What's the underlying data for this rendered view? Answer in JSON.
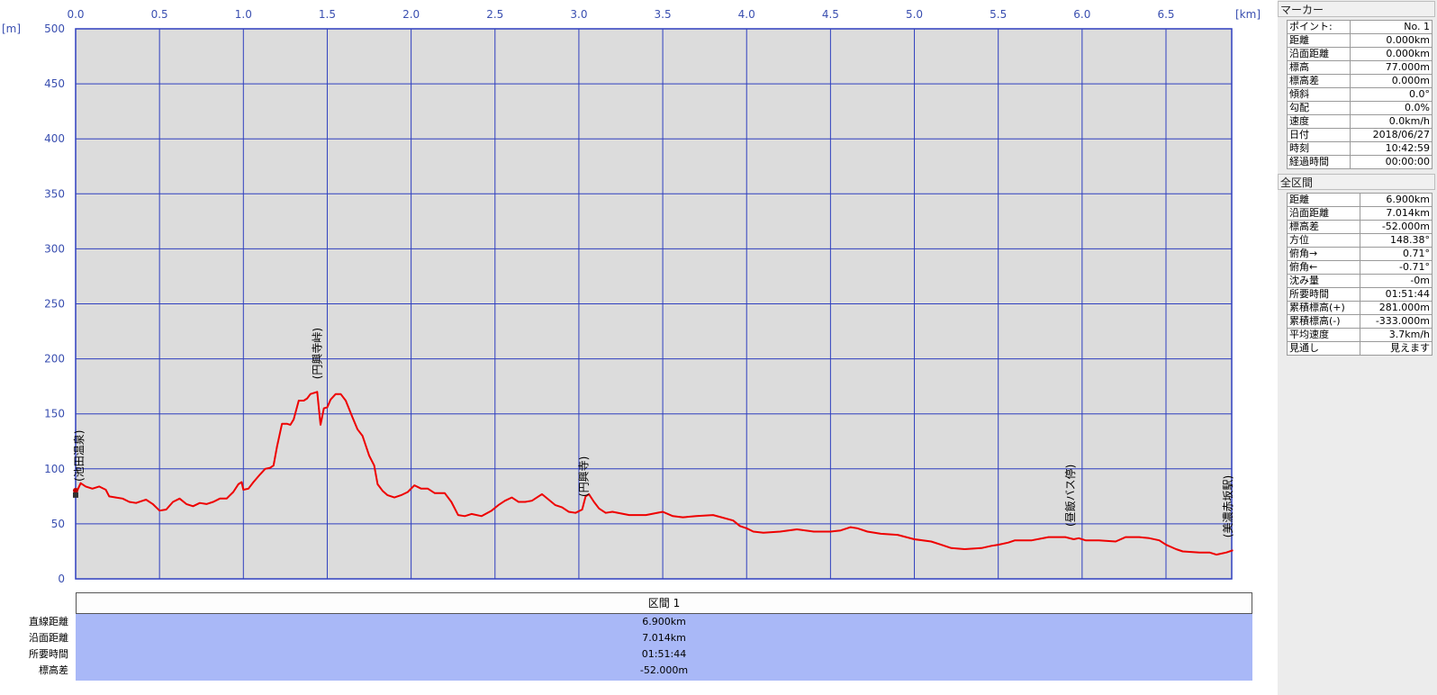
{
  "axes": {
    "x_unit": "[km]",
    "y_unit": "[m]",
    "x_ticks": [
      "0.0",
      "0.5",
      "1.0",
      "1.5",
      "2.0",
      "2.5",
      "3.0",
      "3.5",
      "4.0",
      "4.5",
      "5.0",
      "5.5",
      "6.0",
      "6.5"
    ],
    "y_ticks": [
      "0",
      "50",
      "100",
      "150",
      "200",
      "250",
      "300",
      "350",
      "400",
      "450",
      "500"
    ]
  },
  "colors": {
    "profile": "#ee0000",
    "grid": "#2f3fbf",
    "plot_bg": "#dcdcdc",
    "section_bg": "#a9b8f7"
  },
  "waypoints": [
    {
      "label": "(池田温泉)",
      "x": 0.0
    },
    {
      "label": "(円興寺峠)",
      "x": 1.44
    },
    {
      "label": "(円興寺)",
      "x": 3.03
    },
    {
      "label": "(昼飯バス停)",
      "x": 5.93
    },
    {
      "label": "(美濃赤坂駅)",
      "x": 6.9
    }
  ],
  "chart_data": {
    "type": "line",
    "xlabel": "[km]",
    "ylabel": "[m]",
    "xlim": [
      0,
      6.9
    ],
    "ylim": [
      0,
      500
    ],
    "grid": true,
    "series": [
      {
        "values": [
          [
            0.0,
            77
          ],
          [
            0.03,
            87
          ],
          [
            0.06,
            84
          ],
          [
            0.1,
            82
          ],
          [
            0.14,
            84
          ],
          [
            0.18,
            81
          ],
          [
            0.2,
            75
          ],
          [
            0.24,
            74
          ],
          [
            0.28,
            73
          ],
          [
            0.32,
            70
          ],
          [
            0.36,
            69
          ],
          [
            0.4,
            71
          ],
          [
            0.42,
            72
          ],
          [
            0.46,
            68
          ],
          [
            0.5,
            62
          ],
          [
            0.54,
            63
          ],
          [
            0.58,
            70
          ],
          [
            0.62,
            73
          ],
          [
            0.66,
            68
          ],
          [
            0.7,
            66
          ],
          [
            0.74,
            69
          ],
          [
            0.78,
            68
          ],
          [
            0.82,
            70
          ],
          [
            0.86,
            73
          ],
          [
            0.9,
            73
          ],
          [
            0.94,
            79
          ],
          [
            0.97,
            86
          ],
          [
            0.99,
            88
          ],
          [
            1.0,
            81
          ],
          [
            1.03,
            82
          ],
          [
            1.06,
            88
          ],
          [
            1.1,
            95
          ],
          [
            1.13,
            100
          ],
          [
            1.16,
            101
          ],
          [
            1.18,
            103
          ],
          [
            1.2,
            120
          ],
          [
            1.23,
            141
          ],
          [
            1.26,
            141
          ],
          [
            1.28,
            140
          ],
          [
            1.3,
            145
          ],
          [
            1.33,
            162
          ],
          [
            1.36,
            162
          ],
          [
            1.38,
            164
          ],
          [
            1.4,
            168
          ],
          [
            1.44,
            170
          ],
          [
            1.46,
            140
          ],
          [
            1.48,
            155
          ],
          [
            1.5,
            156
          ],
          [
            1.52,
            163
          ],
          [
            1.55,
            168
          ],
          [
            1.58,
            168
          ],
          [
            1.61,
            162
          ],
          [
            1.65,
            147
          ],
          [
            1.68,
            136
          ],
          [
            1.71,
            130
          ],
          [
            1.75,
            112
          ],
          [
            1.78,
            103
          ],
          [
            1.8,
            86
          ],
          [
            1.83,
            80
          ],
          [
            1.86,
            76
          ],
          [
            1.9,
            74
          ],
          [
            1.94,
            76
          ],
          [
            1.98,
            79
          ],
          [
            2.02,
            85
          ],
          [
            2.06,
            82
          ],
          [
            2.1,
            82
          ],
          [
            2.14,
            78
          ],
          [
            2.2,
            78
          ],
          [
            2.24,
            70
          ],
          [
            2.28,
            58
          ],
          [
            2.32,
            57
          ],
          [
            2.36,
            59
          ],
          [
            2.42,
            57
          ],
          [
            2.48,
            62
          ],
          [
            2.52,
            67
          ],
          [
            2.56,
            71
          ],
          [
            2.6,
            74
          ],
          [
            2.64,
            70
          ],
          [
            2.68,
            70
          ],
          [
            2.72,
            71
          ],
          [
            2.78,
            77
          ],
          [
            2.82,
            72
          ],
          [
            2.86,
            67
          ],
          [
            2.9,
            65
          ],
          [
            2.94,
            61
          ],
          [
            2.98,
            60
          ],
          [
            3.02,
            63
          ],
          [
            3.04,
            75
          ],
          [
            3.06,
            77
          ],
          [
            3.09,
            70
          ],
          [
            3.12,
            64
          ],
          [
            3.16,
            60
          ],
          [
            3.2,
            61
          ],
          [
            3.3,
            58
          ],
          [
            3.4,
            58
          ],
          [
            3.5,
            61
          ],
          [
            3.56,
            57
          ],
          [
            3.62,
            56
          ],
          [
            3.7,
            57
          ],
          [
            3.8,
            58
          ],
          [
            3.85,
            56
          ],
          [
            3.92,
            53
          ],
          [
            3.96,
            48
          ],
          [
            4.0,
            46
          ],
          [
            4.04,
            43
          ],
          [
            4.1,
            42
          ],
          [
            4.2,
            43
          ],
          [
            4.3,
            45
          ],
          [
            4.4,
            43
          ],
          [
            4.5,
            43
          ],
          [
            4.56,
            44
          ],
          [
            4.62,
            47
          ],
          [
            4.66,
            46
          ],
          [
            4.72,
            43
          ],
          [
            4.8,
            41
          ],
          [
            4.9,
            40
          ],
          [
            5.0,
            36
          ],
          [
            5.1,
            34
          ],
          [
            5.16,
            31
          ],
          [
            5.22,
            28
          ],
          [
            5.3,
            27
          ],
          [
            5.4,
            28
          ],
          [
            5.46,
            30
          ],
          [
            5.5,
            31
          ],
          [
            5.56,
            33
          ],
          [
            5.6,
            35
          ],
          [
            5.7,
            35
          ],
          [
            5.8,
            38
          ],
          [
            5.9,
            38
          ],
          [
            5.95,
            36
          ],
          [
            5.98,
            37
          ],
          [
            6.02,
            35
          ],
          [
            6.1,
            35
          ],
          [
            6.2,
            34
          ],
          [
            6.26,
            38
          ],
          [
            6.34,
            38
          ],
          [
            6.4,
            37
          ],
          [
            6.46,
            35
          ],
          [
            6.5,
            31
          ],
          [
            6.56,
            27
          ],
          [
            6.6,
            25
          ],
          [
            6.7,
            24
          ],
          [
            6.76,
            24
          ],
          [
            6.8,
            22
          ],
          [
            6.86,
            24
          ],
          [
            6.9,
            26
          ]
        ]
      }
    ]
  },
  "section": {
    "header": "区間 1",
    "rows": [
      {
        "label": "直線距離",
        "value": "6.900km"
      },
      {
        "label": "沿面距離",
        "value": "7.014km"
      },
      {
        "label": "所要時間",
        "value": "01:51:44"
      },
      {
        "label": "標高差",
        "value": "-52.000m"
      }
    ]
  },
  "marker_panel": {
    "title": "マーカー",
    "rows": [
      {
        "label": "ポイント:",
        "value": "No. 1"
      },
      {
        "label": "距離",
        "value": "0.000km"
      },
      {
        "label": "沿面距離",
        "value": "0.000km"
      },
      {
        "label": "標高",
        "value": "77.000m"
      },
      {
        "label": "標高差",
        "value": "0.000m"
      },
      {
        "label": "傾斜",
        "value": "0.0°"
      },
      {
        "label": "勾配",
        "value": "0.0%"
      },
      {
        "label": "速度",
        "value": "0.0km/h"
      },
      {
        "label": "日付",
        "value": "2018/06/27"
      },
      {
        "label": "時刻",
        "value": "10:42:59"
      },
      {
        "label": "経過時間",
        "value": "00:00:00"
      }
    ]
  },
  "all_panel": {
    "title": "全区間",
    "rows": [
      {
        "label": "距離",
        "value": "6.900km"
      },
      {
        "label": "沿面距離",
        "value": "7.014km"
      },
      {
        "label": "標高差",
        "value": "-52.000m"
      },
      {
        "label": "方位",
        "value": "148.38°"
      },
      {
        "label": "俯角→",
        "value": "0.71°"
      },
      {
        "label": "俯角←",
        "value": "-0.71°"
      },
      {
        "label": "沈み量",
        "value": "-0m"
      },
      {
        "label": "所要時間",
        "value": "01:51:44"
      },
      {
        "label": "累積標高(+)",
        "value": "281.000m"
      },
      {
        "label": "累積標高(-)",
        "value": "-333.000m"
      },
      {
        "label": "平均速度",
        "value": "3.7km/h"
      },
      {
        "label": "見通し",
        "value": "見えます"
      }
    ]
  }
}
